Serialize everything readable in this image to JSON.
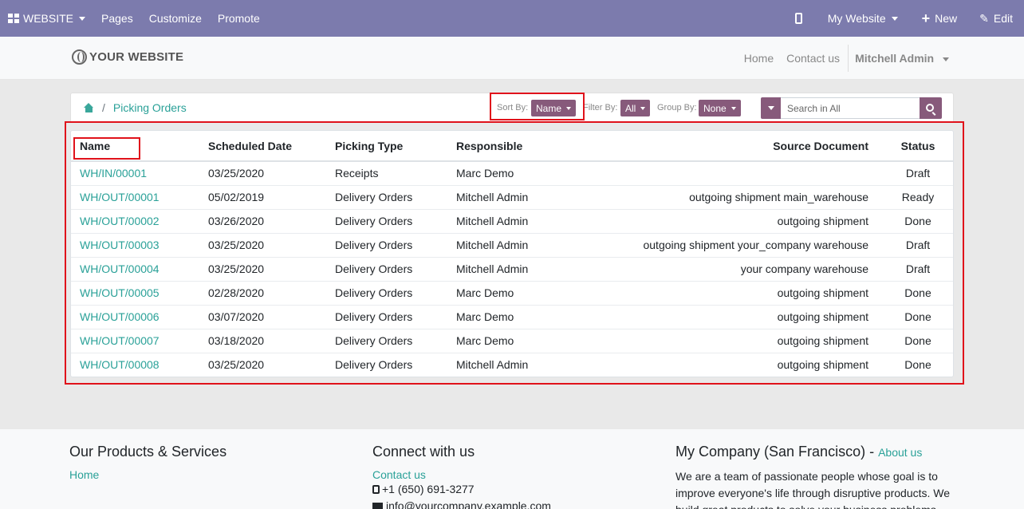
{
  "topbar": {
    "website_menu": "WEBSITE",
    "pages": "Pages",
    "customize": "Customize",
    "promote": "Promote",
    "my_website": "My Website",
    "new": "New",
    "edit": "Edit"
  },
  "header": {
    "logo_text": "YOUR WEBSITE",
    "nav": [
      "Home",
      "Contact us"
    ],
    "user": "Mitchell Admin"
  },
  "breadcrumb": {
    "separator": "/",
    "current": "Picking Orders"
  },
  "controls": {
    "sort_label": "Sort By:",
    "sort_value": "Name",
    "filter_label": "Filter By:",
    "filter_value": "All",
    "group_label": "Group By:",
    "group_value": "None",
    "search_placeholder": "Search in All"
  },
  "table": {
    "columns": [
      "Name",
      "Scheduled Date",
      "Picking Type",
      "Responsible",
      "Source Document",
      "Status"
    ],
    "rows": [
      [
        "WH/IN/00001",
        "03/25/2020",
        "Receipts",
        "Marc Demo",
        "",
        "Draft"
      ],
      [
        "WH/OUT/00001",
        "05/02/2019",
        "Delivery Orders",
        "Mitchell Admin",
        "outgoing shipment main_warehouse",
        "Ready"
      ],
      [
        "WH/OUT/00002",
        "03/26/2020",
        "Delivery Orders",
        "Mitchell Admin",
        "outgoing shipment",
        "Done"
      ],
      [
        "WH/OUT/00003",
        "03/25/2020",
        "Delivery Orders",
        "Mitchell Admin",
        "outgoing shipment your_company warehouse",
        "Draft"
      ],
      [
        "WH/OUT/00004",
        "03/25/2020",
        "Delivery Orders",
        "Mitchell Admin",
        "your company warehouse",
        "Draft"
      ],
      [
        "WH/OUT/00005",
        "02/28/2020",
        "Delivery Orders",
        "Marc Demo",
        "outgoing shipment",
        "Done"
      ],
      [
        "WH/OUT/00006",
        "03/07/2020",
        "Delivery Orders",
        "Marc Demo",
        "outgoing shipment",
        "Done"
      ],
      [
        "WH/OUT/00007",
        "03/18/2020",
        "Delivery Orders",
        "Marc Demo",
        "outgoing shipment",
        "Done"
      ],
      [
        "WH/OUT/00008",
        "03/25/2020",
        "Delivery Orders",
        "Mitchell Admin",
        "outgoing shipment",
        "Done"
      ]
    ]
  },
  "footer": {
    "col1_title": "Our Products & Services",
    "col1_link": "Home",
    "col2_title": "Connect with us",
    "col2_link": "Contact us",
    "phone": "+1 (650) 691-3277",
    "email": "info@yourcompany.example.com",
    "col3_title": "My Company (San Francisco)",
    "col3_dash": " - ",
    "col3_link": "About us",
    "col3_text": "We are a team of passionate people whose goal is to improve everyone's life through disruptive products. We build great products to solve your business problems."
  },
  "colors": {
    "topbar": "#7c7bad",
    "accent": "#875a7b",
    "link": "#2aa198",
    "highlight": "#e0121b"
  }
}
